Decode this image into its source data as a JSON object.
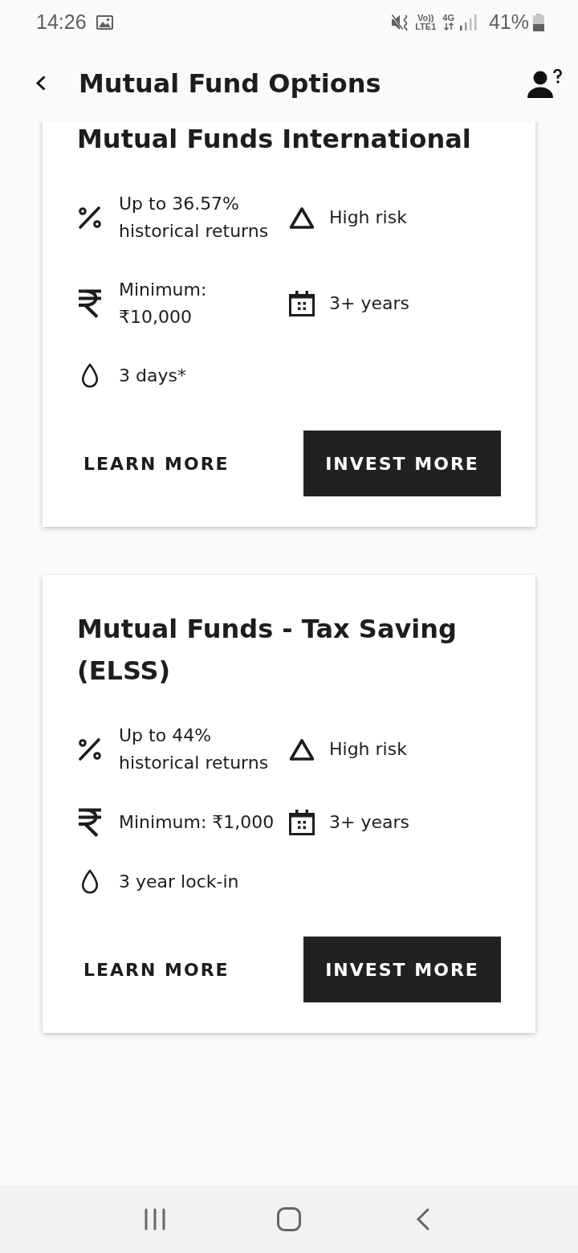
{
  "status_bar": {
    "time": "14:26",
    "voice": "Vo))",
    "network": "LTE1",
    "data": "4G",
    "battery": "41%"
  },
  "app_bar": {
    "title": "Mutual Fund Options"
  },
  "funds": [
    {
      "title": "Mutual Funds International",
      "features": [
        {
          "kind": "returns",
          "text": "Up to 36.57% historical returns"
        },
        {
          "kind": "risk",
          "text": "High risk"
        },
        {
          "kind": "minimum",
          "text": "Minimum: ₹10,000"
        },
        {
          "kind": "horizon",
          "text": "3+ years"
        },
        {
          "kind": "liquidity",
          "text": "3 days*"
        }
      ],
      "buttons": [
        {
          "kind": "text",
          "label": "LEARN MORE"
        },
        {
          "kind": "filled",
          "label": "INVEST MORE"
        }
      ]
    },
    {
      "title": "Mutual Funds - Tax Saving (ELSS)",
      "features": [
        {
          "kind": "returns",
          "text": "Up to 44% historical returns"
        },
        {
          "kind": "risk",
          "text": "High risk"
        },
        {
          "kind": "minimum",
          "text": "Minimum: ₹1,000"
        },
        {
          "kind": "horizon",
          "text": "3+ years"
        },
        {
          "kind": "liquidity",
          "text": "3 year lock-in"
        }
      ],
      "buttons": [
        {
          "kind": "text",
          "label": "LEARN MORE"
        },
        {
          "kind": "filled",
          "label": "INVEST MORE"
        }
      ]
    }
  ]
}
